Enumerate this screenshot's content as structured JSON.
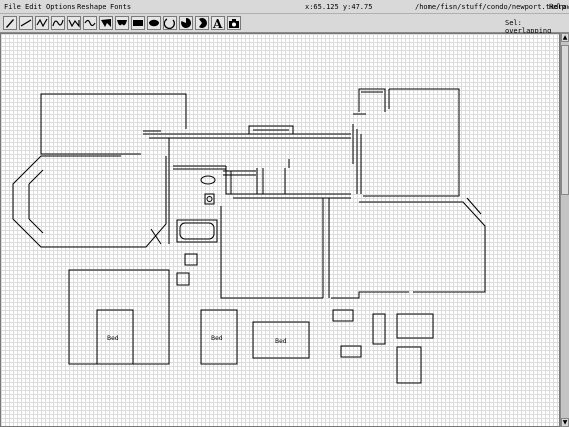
{
  "menu": {
    "file": "File",
    "edit": "Edit",
    "options": "Options",
    "reshape": "Reshape",
    "fonts": "Fonts",
    "help": "Help"
  },
  "status": {
    "coords": "x:65.125 y:47.75",
    "filepath": "/home/fisn/stuff/condo/newport.tkdraw"
  },
  "toolbar": {
    "tools": [
      {
        "name": "pencil-tool"
      },
      {
        "name": "line-tool"
      },
      {
        "name": "polyline-tool"
      },
      {
        "name": "curve-tool"
      },
      {
        "name": "closed-curve-tool"
      },
      {
        "name": "filled-polygon-tool"
      },
      {
        "name": "filled-curve-tool"
      },
      {
        "name": "rectangle-tool"
      },
      {
        "name": "ellipse-tool"
      },
      {
        "name": "arc-tool"
      },
      {
        "name": "filled-arc-tool"
      },
      {
        "name": "filled-chord-tool"
      },
      {
        "name": "text-tool"
      },
      {
        "name": "camera-tool"
      }
    ],
    "sel_label": "Sel: overlapping"
  },
  "floorplan": {
    "labels": [
      "Bed",
      "Bed",
      "Bed"
    ],
    "line_color": "#000000"
  }
}
